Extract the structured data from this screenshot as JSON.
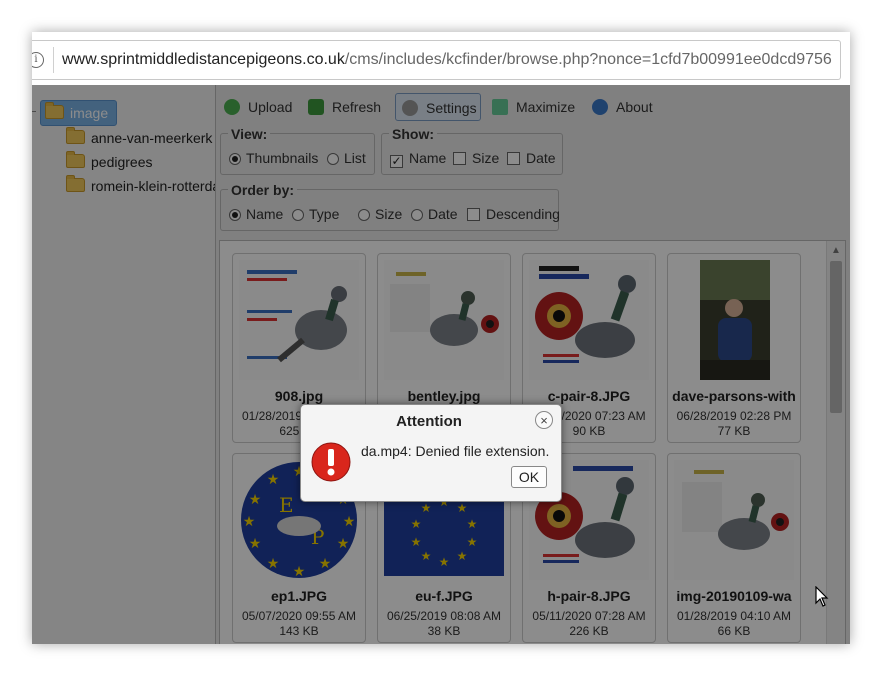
{
  "browser": {
    "url_host": "www.sprintmiddledistancepigeons.co.uk",
    "url_rest": "/cms/includes/kcfinder/browse.php?nonce=1cfd7b00991ee0dcd9756",
    "info_icon": "info-icon"
  },
  "tree": {
    "root": "image",
    "folders": [
      "anne-van-meerkerk",
      "pedigrees",
      "romein-klein-rotterdam"
    ]
  },
  "toolbar": {
    "upload": "Upload",
    "refresh": "Refresh",
    "settings": "Settings",
    "maximize": "Maximize",
    "about": "About"
  },
  "settings": {
    "view_legend": "View:",
    "view_thumbnails": "Thumbnails",
    "view_list": "List",
    "show_legend": "Show:",
    "show_name": "Name",
    "show_size": "Size",
    "show_date": "Date",
    "order_legend": "Order by:",
    "order_name": "Name",
    "order_type": "Type",
    "order_size": "Size",
    "order_date": "Date",
    "order_descending": "Descending"
  },
  "files": [
    {
      "name": "908.jpg",
      "date": "01/28/2019 04:10 AM",
      "size": "625 KB"
    },
    {
      "name": "bentley.jpg",
      "date": "",
      "size": ""
    },
    {
      "name": "c-pair-8.JPG",
      "date": "05/11/2020 07:23 AM",
      "size": "90 KB"
    },
    {
      "name": "dave-parsons-with",
      "date": "06/28/2019 02:28 PM",
      "size": "77 KB"
    },
    {
      "name": "ep1.JPG",
      "date": "05/07/2020 09:55 AM",
      "size": "143 KB"
    },
    {
      "name": "eu-f.JPG",
      "date": "06/25/2019 08:08 AM",
      "size": "38 KB"
    },
    {
      "name": "h-pair-8.JPG",
      "date": "05/11/2020 07:28 AM",
      "size": "226 KB"
    },
    {
      "name": "img-20190109-wa",
      "date": "01/28/2019 04:10 AM",
      "size": "66 KB"
    }
  ],
  "dialog": {
    "title": "Attention",
    "message": "da.mp4: Denied file extension.",
    "ok": "OK",
    "close": "×"
  },
  "colors": {
    "selected_folder": "#7ab3e6",
    "error_icon": "#d9261c",
    "eu_blue": "#1f3f9e",
    "eu_star": "#f5d200"
  }
}
